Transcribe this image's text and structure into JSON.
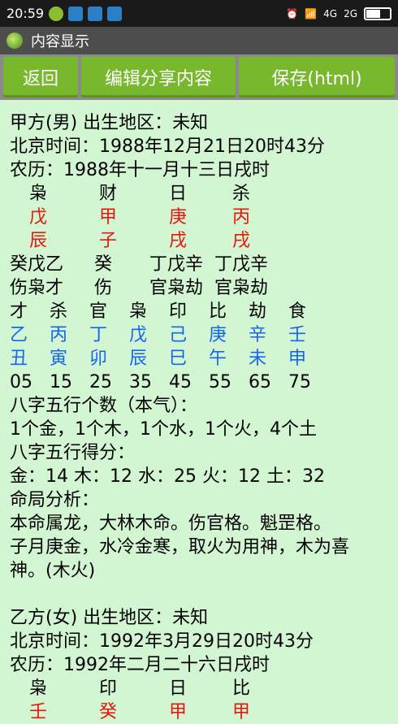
{
  "status": {
    "time": "20:59",
    "network_label": "4G",
    "network_label2": "2G"
  },
  "title": "内容显示",
  "toolbar": {
    "back": "返回",
    "share": "编辑分享内容",
    "save": "保存(html)"
  },
  "person1": {
    "header": "甲方(男) 出生地区：未知",
    "beijing_time": "北京时间：1988年12月21日20时43分",
    "lunar": "农历：1988年十一月十三日戌时",
    "ten_gods": [
      "枭",
      "财",
      "日",
      "杀"
    ],
    "stems": [
      "戊",
      "甲",
      "庚",
      "丙"
    ],
    "branches": [
      "辰",
      "子",
      "戌",
      "戌"
    ],
    "hidden_stems": [
      "癸戊乙",
      "癸",
      "丁戊辛",
      "丁戊辛"
    ],
    "hidden_gods": [
      "伤枭才",
      "伤",
      "官枭劫",
      "官枭劫"
    ],
    "luck_gods": [
      "才",
      "杀",
      "官",
      "枭",
      "印",
      "比",
      "劫",
      "食"
    ],
    "luck_stems": [
      "乙",
      "丙",
      "丁",
      "戊",
      "己",
      "庚",
      "辛",
      "壬"
    ],
    "luck_branches": [
      "丑",
      "寅",
      "卯",
      "辰",
      "巳",
      "午",
      "未",
      "申"
    ],
    "luck_ages": [
      "05",
      "15",
      "25",
      "35",
      "45",
      "55",
      "65",
      "75"
    ],
    "count_title": "八字五行个数（本气）：",
    "count_value": "1个金，1个木，1个水，1个火，4个土",
    "score_title": "八字五行得分：",
    "score_value": "金：14 木：12 水：25 火：12 土：32",
    "analysis_title": "命局分析：",
    "analysis_1": "本命属龙，大林木命。伤官格。魁罡格。",
    "analysis_2": "子月庚金，水冷金寒，取火为用神，木为喜",
    "analysis_3": "神。(木火)"
  },
  "person2": {
    "header": "乙方(女) 出生地区：未知",
    "beijing_time": "北京时间：1992年3月29日20时43分",
    "lunar": "农历：1992年二月二十六日戌时",
    "ten_gods": [
      "枭",
      "印",
      "日",
      "比"
    ],
    "stems": [
      "壬",
      "癸",
      "甲",
      "甲"
    ]
  },
  "colors": {
    "background": "#d2f5d2",
    "button": "#77b82d",
    "stem_red": "#e8160f",
    "luck_blue": "#1565f0"
  }
}
